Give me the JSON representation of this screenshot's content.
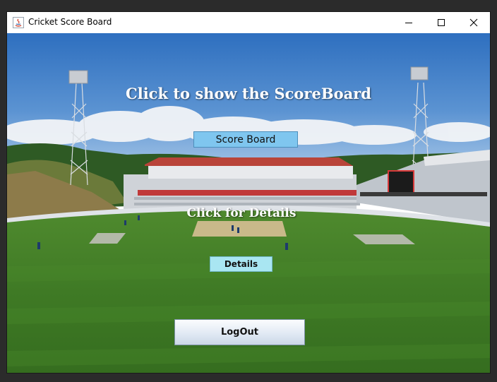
{
  "window": {
    "title": "Cricket Score Board",
    "icons": [
      "java-app-icon",
      "minimize-icon",
      "maximize-icon",
      "close-icon"
    ]
  },
  "main": {
    "scoreboard_prompt": "Click to show the ScoreBoard",
    "scoreboard_button": "Score Board",
    "details_prompt": "Click for Details",
    "details_button": "Details",
    "logout_button": "LogOut"
  },
  "colors": {
    "scoreboard_button_bg": "#7fc6ef",
    "details_button_bg": "#a9e6f2",
    "heading_text": "#ffffff"
  }
}
